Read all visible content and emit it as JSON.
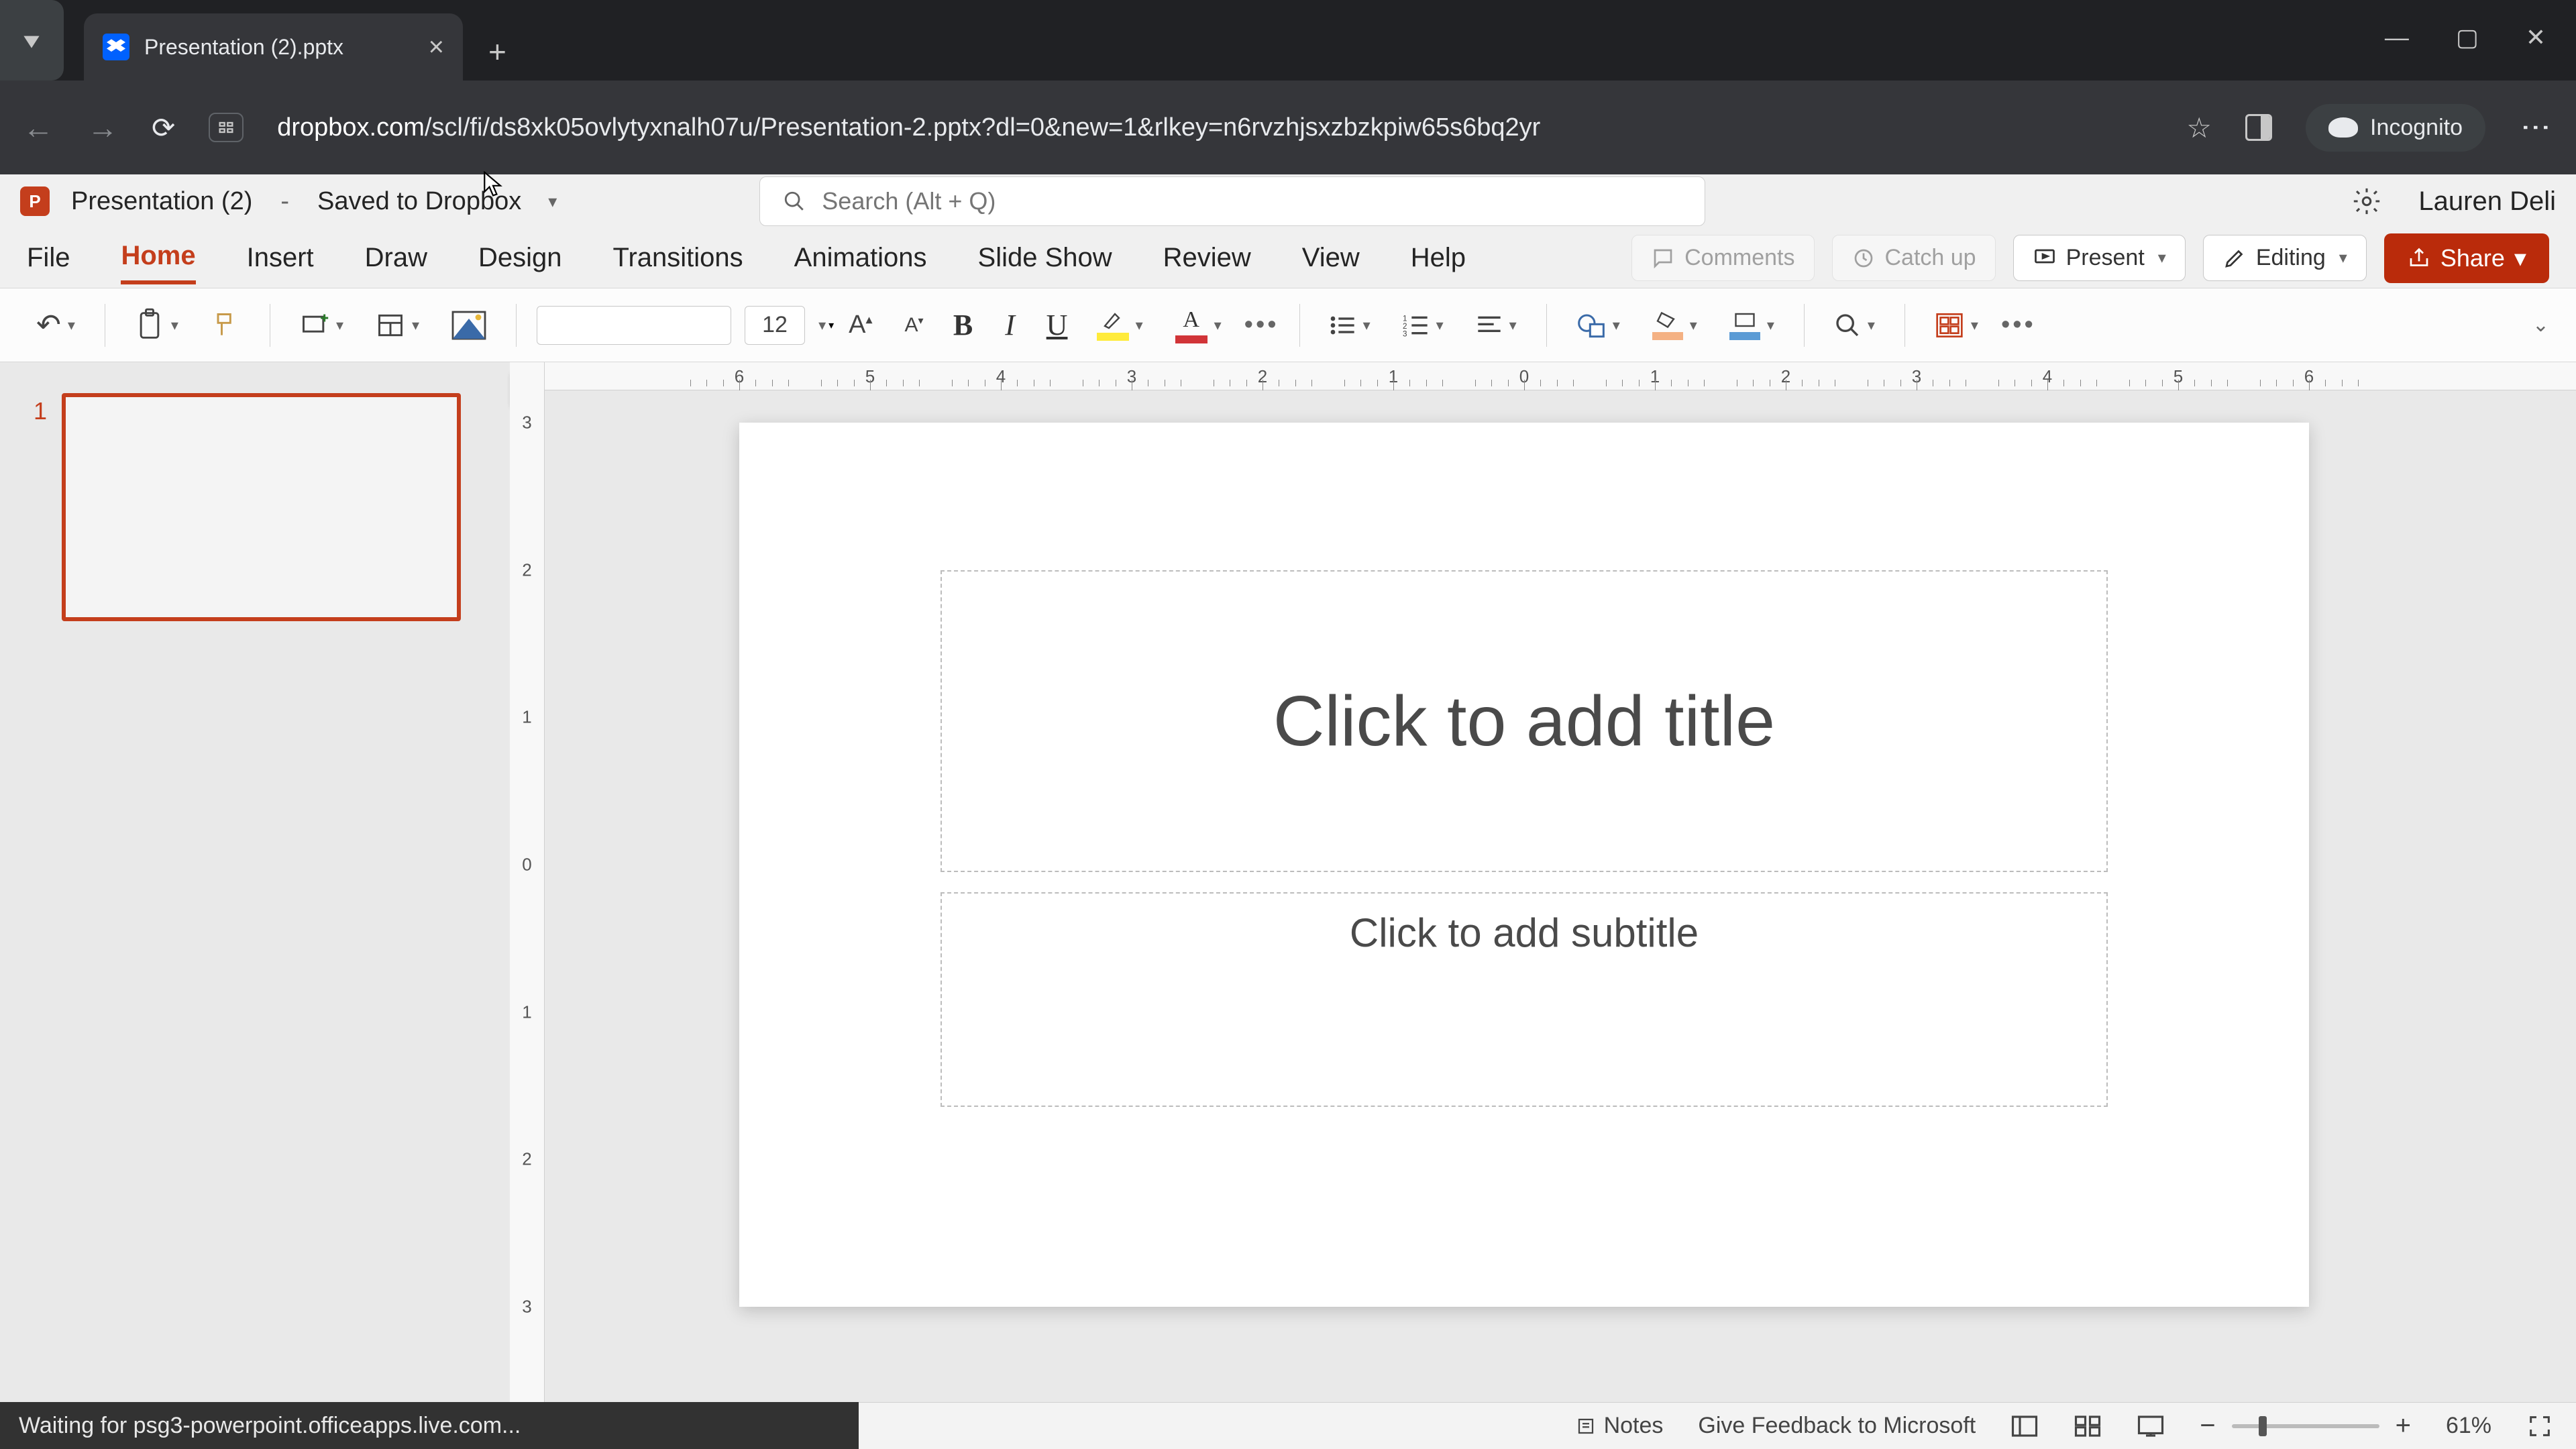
{
  "browser": {
    "tab_title": "Presentation (2).pptx",
    "url_domain": "dropbox.com",
    "url_path": "/scl/fi/ds8xk05ovlytyxnalh07u/Presentation-2.pptx?dl=0&new=1&rlkey=n6rvzhjsxzbzkpiw65s6bq2yr",
    "incognito_label": "Incognito"
  },
  "header": {
    "doc_title": "Presentation (2)",
    "save_status": "Saved to Dropbox",
    "search_placeholder": "Search (Alt + Q)",
    "user_name": "Lauren Deli"
  },
  "ribbon": {
    "tabs": [
      "File",
      "Home",
      "Insert",
      "Draw",
      "Design",
      "Transitions",
      "Animations",
      "Slide Show",
      "Review",
      "View",
      "Help"
    ],
    "active_index": 1,
    "actions": {
      "comments": "Comments",
      "catchup": "Catch up",
      "present": "Present",
      "editing": "Editing",
      "share": "Share"
    }
  },
  "toolbar": {
    "font_size": "12"
  },
  "ruler": {
    "h_labels": [
      "6",
      "5",
      "4",
      "3",
      "2",
      "1",
      "0",
      "1",
      "2",
      "3",
      "4",
      "5",
      "6"
    ],
    "v_labels": [
      "3",
      "2",
      "1",
      "0",
      "1",
      "2",
      "3"
    ]
  },
  "slide": {
    "title_placeholder": "Click to add title",
    "subtitle_placeholder": "Click to add subtitle"
  },
  "thumbs": {
    "first_num": "1"
  },
  "status": {
    "loading": "Waiting for psg3-powerpoint.officeapps.live.com...",
    "notes": "Notes",
    "feedback": "Give Feedback to Microsoft",
    "zoom_pct": "61%"
  }
}
